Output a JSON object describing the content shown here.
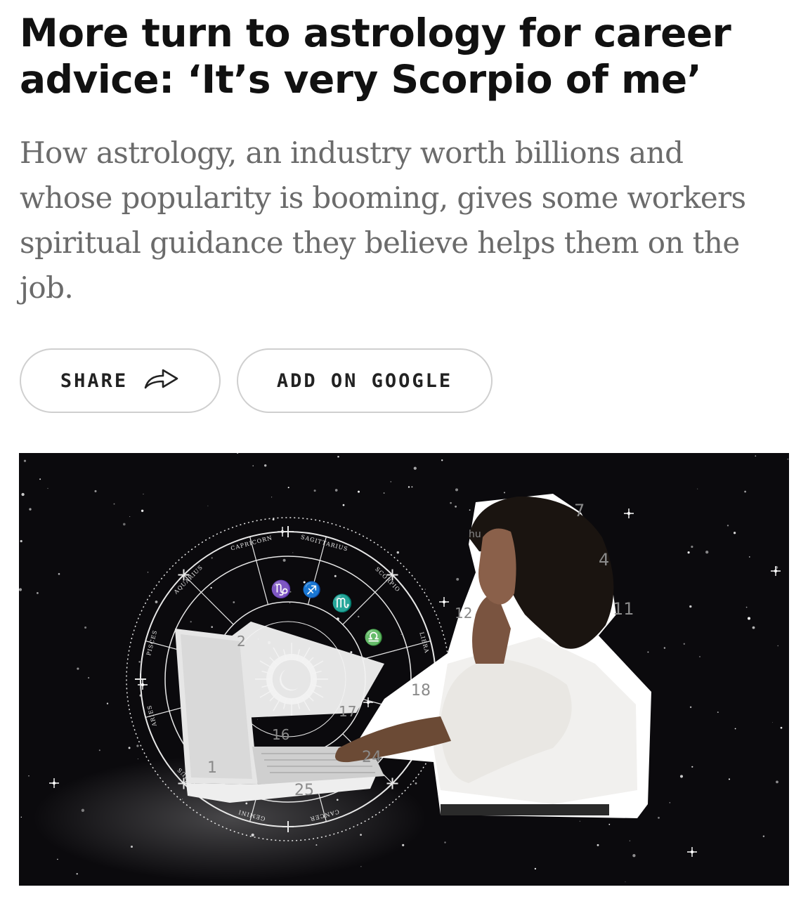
{
  "article": {
    "headline": "More turn to astrology for career advice: ‘It’s very Scorpio of me’",
    "dek": "How astrology, an industry worth billions and whose popularity is booming, gives some workers spiritual guidance they believe helps them on the job."
  },
  "actions": {
    "share_label": "SHARE",
    "google_label": "ADD ON GOOGLE"
  },
  "hero": {
    "zodiac_labels": [
      "CAPRICORN",
      "SAGITTARIUS",
      "SCORPIO",
      "LIBRA",
      "AQUARIUS",
      "PISCES",
      "ARIES",
      "TAURUS",
      "GEMINI",
      "CANCER"
    ],
    "calendar_numbers": [
      "7",
      "4",
      "11",
      "12",
      "18",
      "24",
      "25",
      "16",
      "1",
      "2",
      "17",
      "hu"
    ]
  },
  "icons": {
    "share": "share-arrow-icon"
  },
  "colors": {
    "text": "#111111",
    "dek": "#6b6b6b",
    "pill_border": "#cfcfcf",
    "hero_bg": "#0b0a0d"
  }
}
